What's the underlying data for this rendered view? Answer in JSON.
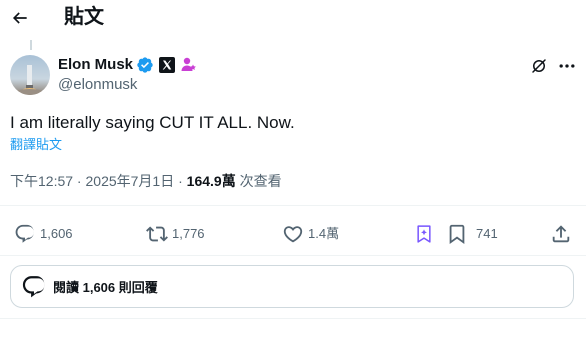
{
  "header": {
    "title": "貼文",
    "back_icon": "arrow-left-icon"
  },
  "author": {
    "display_name": "Elon Musk",
    "handle": "@elonmusk",
    "verified_color": "#1d9bf0",
    "affiliate_badge_icon": "x-logo-icon",
    "role_badge_icon": "person-badge-icon",
    "role_badge_color": "#c93fd4"
  },
  "tweet": {
    "text": "I am literally saying CUT IT ALL. Now.",
    "translate_label": "翻譯貼文",
    "time": "下午12:57",
    "separator1": " · ",
    "date": "2025年7月1日",
    "separator2": " · ",
    "views_count": "164.9萬",
    "views_label": " 次查看"
  },
  "actions": {
    "replies": "1,606",
    "reposts": "1,776",
    "likes": "1.4萬",
    "bookmarks": "741"
  },
  "reply_card": {
    "label": "閱讀 1,606 則回覆"
  },
  "colors": {
    "accent": "#1d9bf0",
    "muted": "#536471",
    "text": "#0f1419",
    "grok_purple": "#7856ff"
  }
}
